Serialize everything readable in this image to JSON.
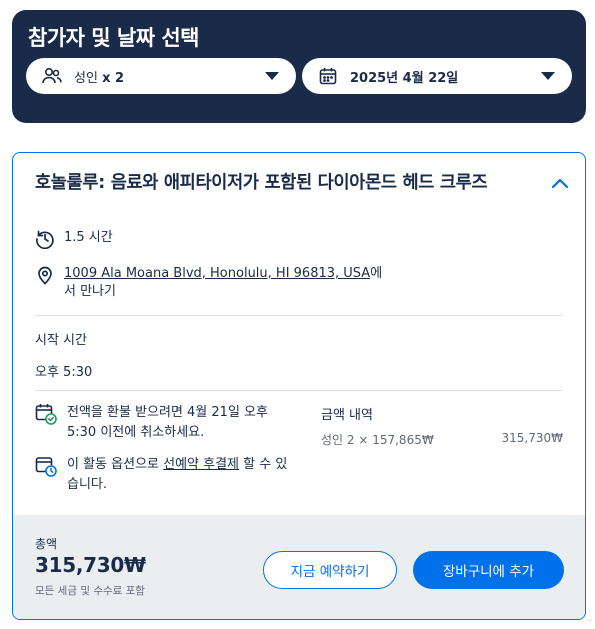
{
  "header": {
    "title": "참가자 및 날짜 선택",
    "participants": {
      "prefix": "성인",
      "value": "x 2",
      "icon": "users-icon"
    },
    "date": {
      "value": "2025년 4월 22일",
      "icon": "calendar-icon"
    }
  },
  "option": {
    "title": "호놀룰루: 음료와 애피타이저가 포함된 다이아몬드 헤드 크루즈",
    "duration": "1.5 시간",
    "location": {
      "address": "1009 Ala Moana Blvd, Honolulu, HI 96813, USA",
      "suffix": "에서 만나기"
    },
    "start_label": "시작 시간",
    "start_time": "오후 5:30",
    "refund": "전액을 환불 받으려면 4월 21일 오후 5:30 이전에 취소하세요.",
    "reserve": {
      "prefix": "이 활동 옵션으로 ",
      "link": "선예약 후결제",
      "suffix": " 할 수 있습니다."
    },
    "price": {
      "heading": "금액 내역",
      "line": "성인 2 × 157,865₩",
      "line_total": "315,730₩"
    }
  },
  "footer": {
    "total_label": "총액",
    "total_amount": "315,730₩",
    "total_note": "모든 세금 및 수수료 포함",
    "reserve_button": "지금 예약하기",
    "cart_button": "장바구니에 추가"
  },
  "colors": {
    "navy": "#1a2b49",
    "accent": "#0071eb",
    "footer_bg": "#ebeef1",
    "check_green": "#1a9e5a"
  }
}
